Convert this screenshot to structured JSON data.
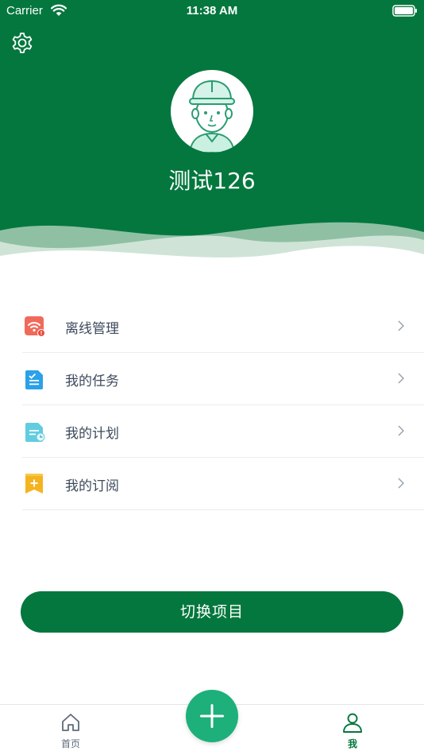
{
  "status_bar": {
    "carrier": "Carrier",
    "time": "11:38 AM"
  },
  "profile": {
    "username": "测试126"
  },
  "menu": {
    "items": [
      {
        "label": "离线管理",
        "icon": "offline-wifi-icon",
        "color": "#f06a5a"
      },
      {
        "label": "我的任务",
        "icon": "task-document-icon",
        "color": "#2aa1e8"
      },
      {
        "label": "我的计划",
        "icon": "plan-document-icon",
        "color": "#62cce0"
      },
      {
        "label": "我的订阅",
        "icon": "subscription-bookmark-icon",
        "color": "#f5b320"
      }
    ]
  },
  "switch_button": {
    "label": "切换项目"
  },
  "tabbar": {
    "home": {
      "label": "首页"
    },
    "me": {
      "label": "我"
    }
  },
  "colors": {
    "brand": "#04773e",
    "fab": "#1db07a",
    "text": "#3d4a5c"
  }
}
